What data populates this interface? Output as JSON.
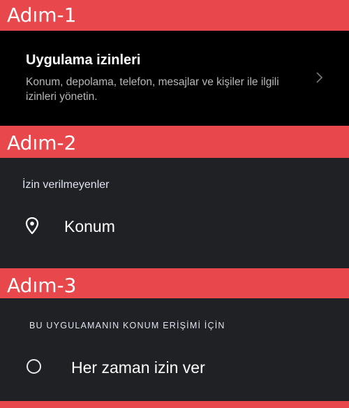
{
  "steps": [
    {
      "label": "Adım-1"
    },
    {
      "label": "Adım-2"
    },
    {
      "label": "Adım-3"
    }
  ],
  "step1": {
    "title": "Uygulama izinleri",
    "description": "Konum, depolama, telefon, mesajlar ve kişiler ile ilgili izinleri yönetin.",
    "chevron_icon": "chevron-right-icon"
  },
  "step2": {
    "section_header": "İzin verilmeyenler",
    "item_label": "Konum",
    "item_icon": "location-pin-icon"
  },
  "step3": {
    "section_header": "BU UYGULAMANIN KONUM ERİŞİMİ İÇİN",
    "option_label": "Her zaman izin ver",
    "option_selected": false
  },
  "colors": {
    "banner": "#e8474c",
    "panel_dark": "#202124",
    "panel_black": "#000000",
    "text_primary": "#ffffff",
    "text_secondary": "#b8b8b8"
  }
}
